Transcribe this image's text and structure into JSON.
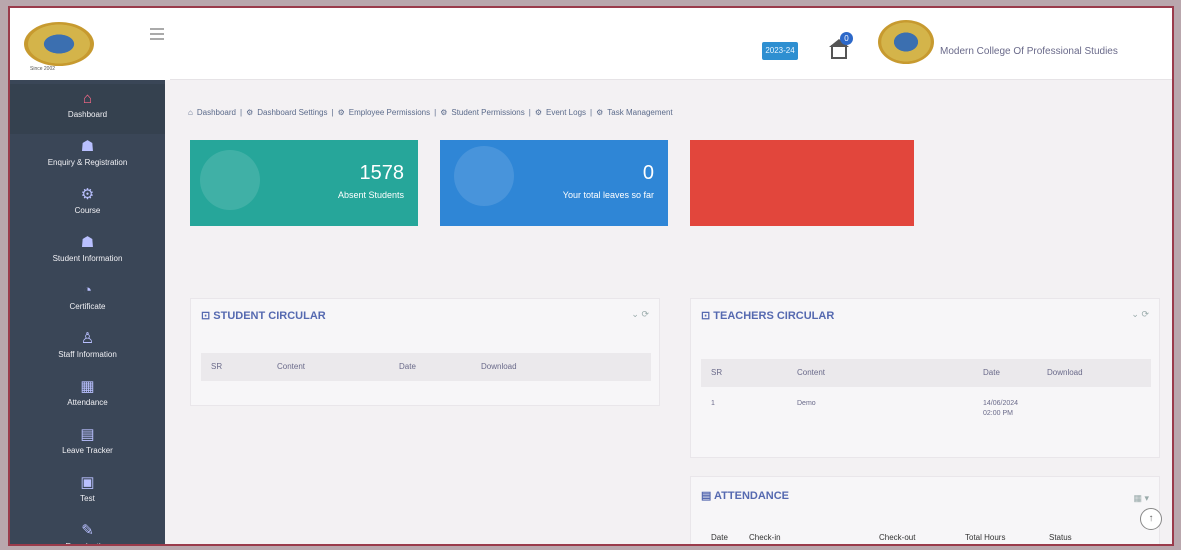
{
  "header": {
    "year": "2023-24",
    "notification_count": "0",
    "college_name": "Modern College Of Professional Studies",
    "logo_subtext": "Since 2002"
  },
  "sidebar": {
    "items": [
      {
        "label": "Dashboard",
        "icon": "home-icon",
        "glyph": "⌂"
      },
      {
        "label": "Enquiry & Registration",
        "icon": "users-icon",
        "glyph": "☗"
      },
      {
        "label": "Course",
        "icon": "settings-icon",
        "glyph": "⚙"
      },
      {
        "label": "Student Information",
        "icon": "student-icon",
        "glyph": "☗"
      },
      {
        "label": "Certificate",
        "icon": "certificate-icon",
        "glyph": "◔"
      },
      {
        "label": "Staff Information",
        "icon": "staff-icon",
        "glyph": "♙"
      },
      {
        "label": "Attendance",
        "icon": "calendar-icon",
        "glyph": "▦"
      },
      {
        "label": "Leave Tracker",
        "icon": "leave-icon",
        "glyph": "▤"
      },
      {
        "label": "Test",
        "icon": "test-icon",
        "glyph": "▣"
      },
      {
        "label": "Examination",
        "icon": "exam-icon",
        "glyph": "✎"
      }
    ]
  },
  "breadcrumb": [
    "Dashboard",
    "Dashboard Settings",
    "Employee Permissions",
    "Student Permissions",
    "Event Logs",
    "Task Management"
  ],
  "cards": [
    {
      "value": "1578",
      "label": "Absent Students",
      "color": "#26a69a"
    },
    {
      "value": "0",
      "label": "Your total leaves so far",
      "color": "#2f86d6"
    },
    {
      "value": "",
      "label": "",
      "color": "#e2463c"
    }
  ],
  "student_circular": {
    "title": "STUDENT CIRCULAR",
    "columns": [
      "SR",
      "Content",
      "Date",
      "Download"
    ]
  },
  "teachers_circular": {
    "title": "TEACHERS CIRCULAR",
    "columns": [
      "SR",
      "Content",
      "Date",
      "Download"
    ],
    "rows": [
      {
        "sr": "1",
        "content": "Demo",
        "date": "14/06/2024",
        "time": "02:00 PM"
      }
    ]
  },
  "attendance": {
    "title": "ATTENDANCE",
    "columns": [
      "Date",
      "Check-in",
      "Check-out",
      "Total Hours",
      "Status"
    ]
  }
}
